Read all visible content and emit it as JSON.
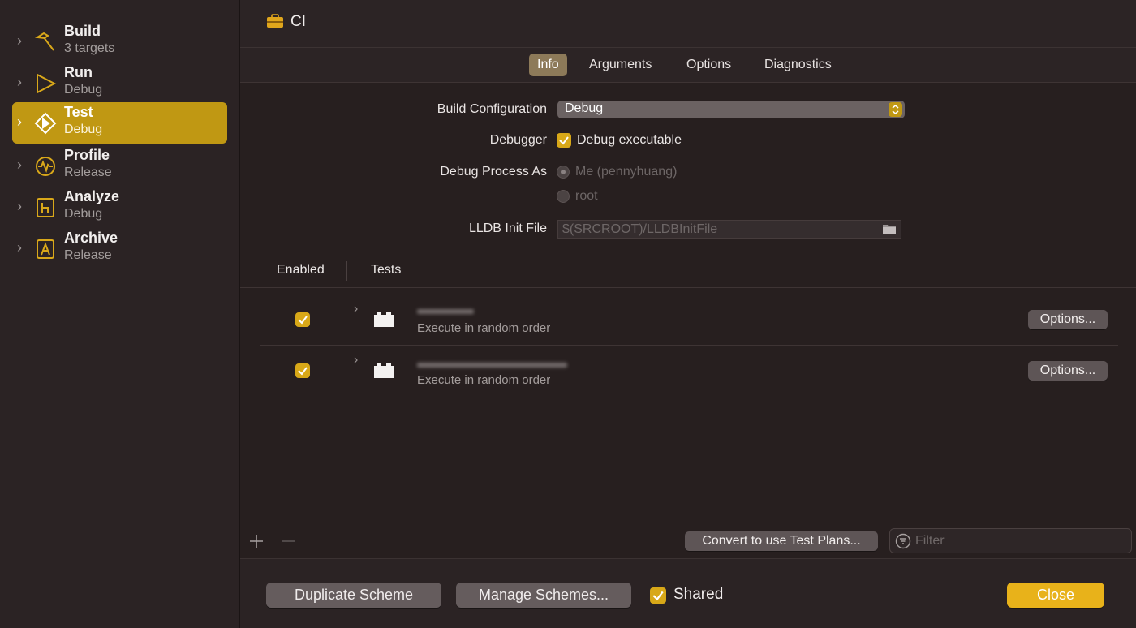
{
  "sidebar": {
    "items": [
      {
        "title": "Build",
        "subtitle": "3 targets",
        "icon": "hammer-icon"
      },
      {
        "title": "Run",
        "subtitle": "Debug",
        "icon": "play-icon"
      },
      {
        "title": "Test",
        "subtitle": "Debug",
        "icon": "test-diamond-icon",
        "selected": true
      },
      {
        "title": "Profile",
        "subtitle": "Release",
        "icon": "waveform-icon"
      },
      {
        "title": "Analyze",
        "subtitle": "Debug",
        "icon": "analyze-icon"
      },
      {
        "title": "Archive",
        "subtitle": "Release",
        "icon": "archive-icon"
      }
    ]
  },
  "header": {
    "title": "CI",
    "icon": "toolbox-icon"
  },
  "tabs": [
    {
      "label": "Info",
      "active": true
    },
    {
      "label": "Arguments"
    },
    {
      "label": "Options"
    },
    {
      "label": "Diagnostics"
    }
  ],
  "info": {
    "build_configuration": {
      "label": "Build Configuration",
      "value": "Debug"
    },
    "debugger": {
      "label": "Debugger",
      "checkbox_label": "Debug executable",
      "checked": true
    },
    "debug_process_as": {
      "label": "Debug Process As",
      "options": [
        {
          "label": "Me (pennyhuang)",
          "selected": true,
          "disabled": true
        },
        {
          "label": "root",
          "selected": false,
          "disabled": true
        }
      ]
    },
    "lldb_init": {
      "label": "LLDB Init File",
      "placeholder": "$(SRCROOT)/LLDBInitFile"
    }
  },
  "tests_table": {
    "columns": [
      "Enabled",
      "Tests"
    ],
    "rows": [
      {
        "enabled": true,
        "subtitle": "Execute in random order",
        "options_label": "Options..."
      },
      {
        "enabled": true,
        "subtitle": "Execute in random order",
        "options_label": "Options..."
      }
    ]
  },
  "toolbar": {
    "convert_label": "Convert to use Test Plans...",
    "filter_placeholder": "Filter"
  },
  "footer": {
    "duplicate_label": "Duplicate Scheme",
    "manage_label": "Manage Schemes...",
    "shared_label": "Shared",
    "shared_checked": true,
    "close_label": "Close"
  },
  "colors": {
    "accent": "#c09813",
    "primary_button": "#e8b21a"
  }
}
